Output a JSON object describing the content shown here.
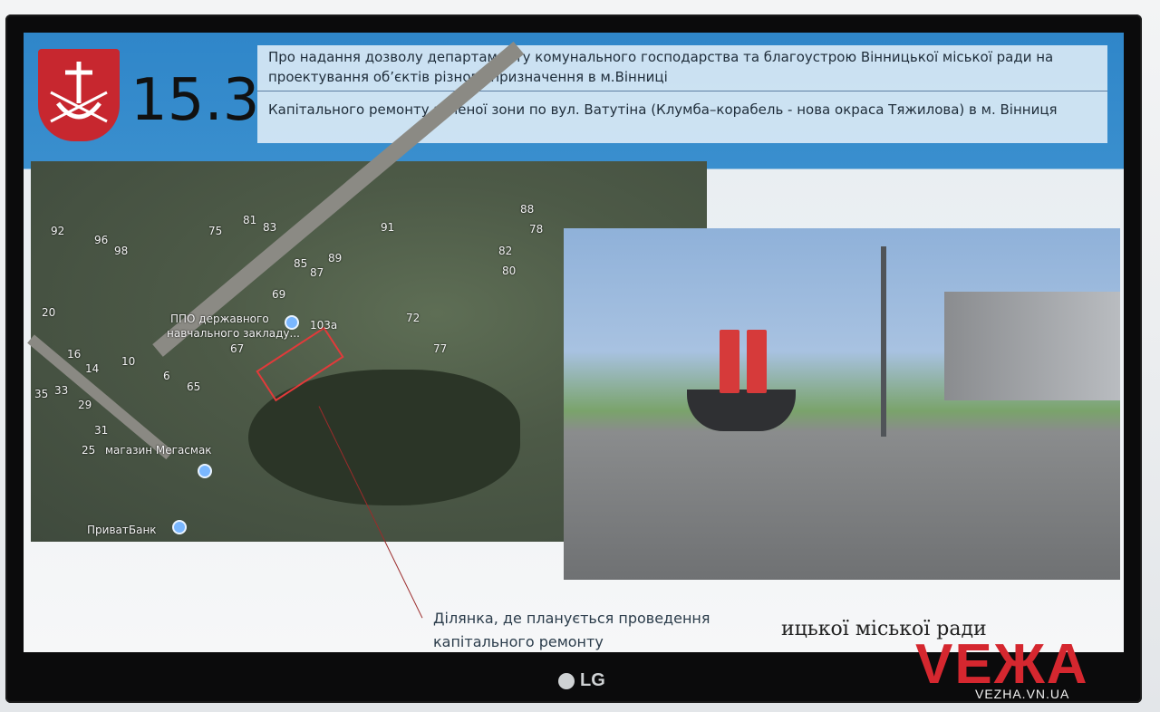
{
  "slide": {
    "number": "15.3",
    "header_line1": "Про надання дозволу департаменту комунального господарства та благоустрою Вінницької міської ради на проектування об’єктів різного призначення в м.Вінниці",
    "header_line2": "Капітального ремонту зеленої зони по вул. Ватутіна (Клумба–корабель - нова окраса Тяжилова) в м. Вінниця",
    "callout_line1": "Ділянка, де планується проведення",
    "callout_line2": "капітального ремонту",
    "bottom_text": "ицької міської ради"
  },
  "map": {
    "labels": [
      {
        "text": "ППО державного"
      },
      {
        "text": "навчального закладу..."
      },
      {
        "text": "магазин Мегасмак"
      },
      {
        "text": "ПриватБанк"
      },
      {
        "text": "103а"
      }
    ],
    "numbers": [
      "92",
      "96",
      "98",
      "75",
      "81",
      "83",
      "91",
      "88",
      "78",
      "82",
      "80",
      "85",
      "87",
      "89",
      "69",
      "72",
      "77",
      "67",
      "65",
      "6",
      "16",
      "14",
      "10",
      "20",
      "35",
      "33",
      "29",
      "31",
      "25"
    ]
  },
  "tv": {
    "brand": "LG"
  },
  "watermark": {
    "brand": "VEЖA",
    "url": "VEZHA.VN.UA"
  },
  "colors": {
    "header_blue": "#2f86c9",
    "highlight_red": "#e23a3a",
    "brand_red": "#d5272f"
  }
}
